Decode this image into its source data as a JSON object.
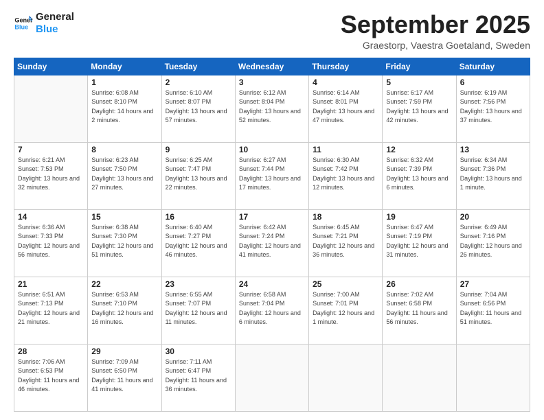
{
  "header": {
    "logo": {
      "line1": "General",
      "line2": "Blue"
    },
    "title": "September 2025",
    "location": "Graestorp, Vaestra Goetaland, Sweden"
  },
  "weekdays": [
    "Sunday",
    "Monday",
    "Tuesday",
    "Wednesday",
    "Thursday",
    "Friday",
    "Saturday"
  ],
  "weeks": [
    [
      {
        "day": "",
        "empty": true
      },
      {
        "day": "1",
        "sunrise": "6:08 AM",
        "sunset": "8:10 PM",
        "daylight": "14 hours and 2 minutes."
      },
      {
        "day": "2",
        "sunrise": "6:10 AM",
        "sunset": "8:07 PM",
        "daylight": "13 hours and 57 minutes."
      },
      {
        "day": "3",
        "sunrise": "6:12 AM",
        "sunset": "8:04 PM",
        "daylight": "13 hours and 52 minutes."
      },
      {
        "day": "4",
        "sunrise": "6:14 AM",
        "sunset": "8:01 PM",
        "daylight": "13 hours and 47 minutes."
      },
      {
        "day": "5",
        "sunrise": "6:17 AM",
        "sunset": "7:59 PM",
        "daylight": "13 hours and 42 minutes."
      },
      {
        "day": "6",
        "sunrise": "6:19 AM",
        "sunset": "7:56 PM",
        "daylight": "13 hours and 37 minutes."
      }
    ],
    [
      {
        "day": "7",
        "sunrise": "6:21 AM",
        "sunset": "7:53 PM",
        "daylight": "13 hours and 32 minutes."
      },
      {
        "day": "8",
        "sunrise": "6:23 AM",
        "sunset": "7:50 PM",
        "daylight": "13 hours and 27 minutes."
      },
      {
        "day": "9",
        "sunrise": "6:25 AM",
        "sunset": "7:47 PM",
        "daylight": "13 hours and 22 minutes."
      },
      {
        "day": "10",
        "sunrise": "6:27 AM",
        "sunset": "7:44 PM",
        "daylight": "13 hours and 17 minutes."
      },
      {
        "day": "11",
        "sunrise": "6:30 AM",
        "sunset": "7:42 PM",
        "daylight": "13 hours and 12 minutes."
      },
      {
        "day": "12",
        "sunrise": "6:32 AM",
        "sunset": "7:39 PM",
        "daylight": "13 hours and 6 minutes."
      },
      {
        "day": "13",
        "sunrise": "6:34 AM",
        "sunset": "7:36 PM",
        "daylight": "13 hours and 1 minute."
      }
    ],
    [
      {
        "day": "14",
        "sunrise": "6:36 AM",
        "sunset": "7:33 PM",
        "daylight": "12 hours and 56 minutes."
      },
      {
        "day": "15",
        "sunrise": "6:38 AM",
        "sunset": "7:30 PM",
        "daylight": "12 hours and 51 minutes."
      },
      {
        "day": "16",
        "sunrise": "6:40 AM",
        "sunset": "7:27 PM",
        "daylight": "12 hours and 46 minutes."
      },
      {
        "day": "17",
        "sunrise": "6:42 AM",
        "sunset": "7:24 PM",
        "daylight": "12 hours and 41 minutes."
      },
      {
        "day": "18",
        "sunrise": "6:45 AM",
        "sunset": "7:21 PM",
        "daylight": "12 hours and 36 minutes."
      },
      {
        "day": "19",
        "sunrise": "6:47 AM",
        "sunset": "7:19 PM",
        "daylight": "12 hours and 31 minutes."
      },
      {
        "day": "20",
        "sunrise": "6:49 AM",
        "sunset": "7:16 PM",
        "daylight": "12 hours and 26 minutes."
      }
    ],
    [
      {
        "day": "21",
        "sunrise": "6:51 AM",
        "sunset": "7:13 PM",
        "daylight": "12 hours and 21 minutes."
      },
      {
        "day": "22",
        "sunrise": "6:53 AM",
        "sunset": "7:10 PM",
        "daylight": "12 hours and 16 minutes."
      },
      {
        "day": "23",
        "sunrise": "6:55 AM",
        "sunset": "7:07 PM",
        "daylight": "12 hours and 11 minutes."
      },
      {
        "day": "24",
        "sunrise": "6:58 AM",
        "sunset": "7:04 PM",
        "daylight": "12 hours and 6 minutes."
      },
      {
        "day": "25",
        "sunrise": "7:00 AM",
        "sunset": "7:01 PM",
        "daylight": "12 hours and 1 minute."
      },
      {
        "day": "26",
        "sunrise": "7:02 AM",
        "sunset": "6:58 PM",
        "daylight": "11 hours and 56 minutes."
      },
      {
        "day": "27",
        "sunrise": "7:04 AM",
        "sunset": "6:56 PM",
        "daylight": "11 hours and 51 minutes."
      }
    ],
    [
      {
        "day": "28",
        "sunrise": "7:06 AM",
        "sunset": "6:53 PM",
        "daylight": "11 hours and 46 minutes."
      },
      {
        "day": "29",
        "sunrise": "7:09 AM",
        "sunset": "6:50 PM",
        "daylight": "11 hours and 41 minutes."
      },
      {
        "day": "30",
        "sunrise": "7:11 AM",
        "sunset": "6:47 PM",
        "daylight": "11 hours and 36 minutes."
      },
      {
        "day": "",
        "empty": true
      },
      {
        "day": "",
        "empty": true
      },
      {
        "day": "",
        "empty": true
      },
      {
        "day": "",
        "empty": true
      }
    ]
  ]
}
